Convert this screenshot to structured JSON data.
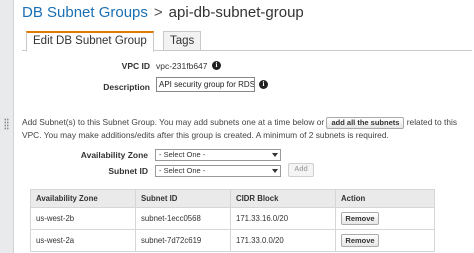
{
  "header": {
    "breadcrumb_root": "DB Subnet Groups",
    "separator": ">",
    "current": "api-db-subnet-group"
  },
  "tabs": [
    {
      "label": "Edit DB Subnet Group",
      "active": true
    },
    {
      "label": "Tags",
      "active": false
    }
  ],
  "form": {
    "vpc_label": "VPC ID",
    "vpc_value": "vpc-231fb647",
    "description_label": "Description",
    "description_value": "API security group for RDS c",
    "info_glyph": "i"
  },
  "help": {
    "text_before": "Add Subnet(s) to this Subnet Group. You may add subnets one at a time below or",
    "add_all_label": "add all the subnets",
    "text_after": "related to this VPC. You may make additions/edits after this group is created. A minimum of 2 subnets is required."
  },
  "selectors": {
    "az_label": "Availability Zone",
    "az_value": "- Select One -",
    "subnet_label": "Subnet ID",
    "subnet_value": "- Select One -",
    "add_label": "Add"
  },
  "table": {
    "columns": [
      "Availability Zone",
      "Subnet ID",
      "CIDR Block",
      "Action"
    ],
    "rows": [
      {
        "az": "us-west-2b",
        "subnet": "subnet-1ecc0568",
        "cidr": "171.33.16.0/20",
        "action": "Remove"
      },
      {
        "az": "us-west-2a",
        "subnet": "subnet-7d72c619",
        "cidr": "171.33.0.0/20",
        "action": "Remove"
      }
    ]
  },
  "colors": {
    "link": "#1b6fb3",
    "active_tab_accent": "#e07b00"
  }
}
